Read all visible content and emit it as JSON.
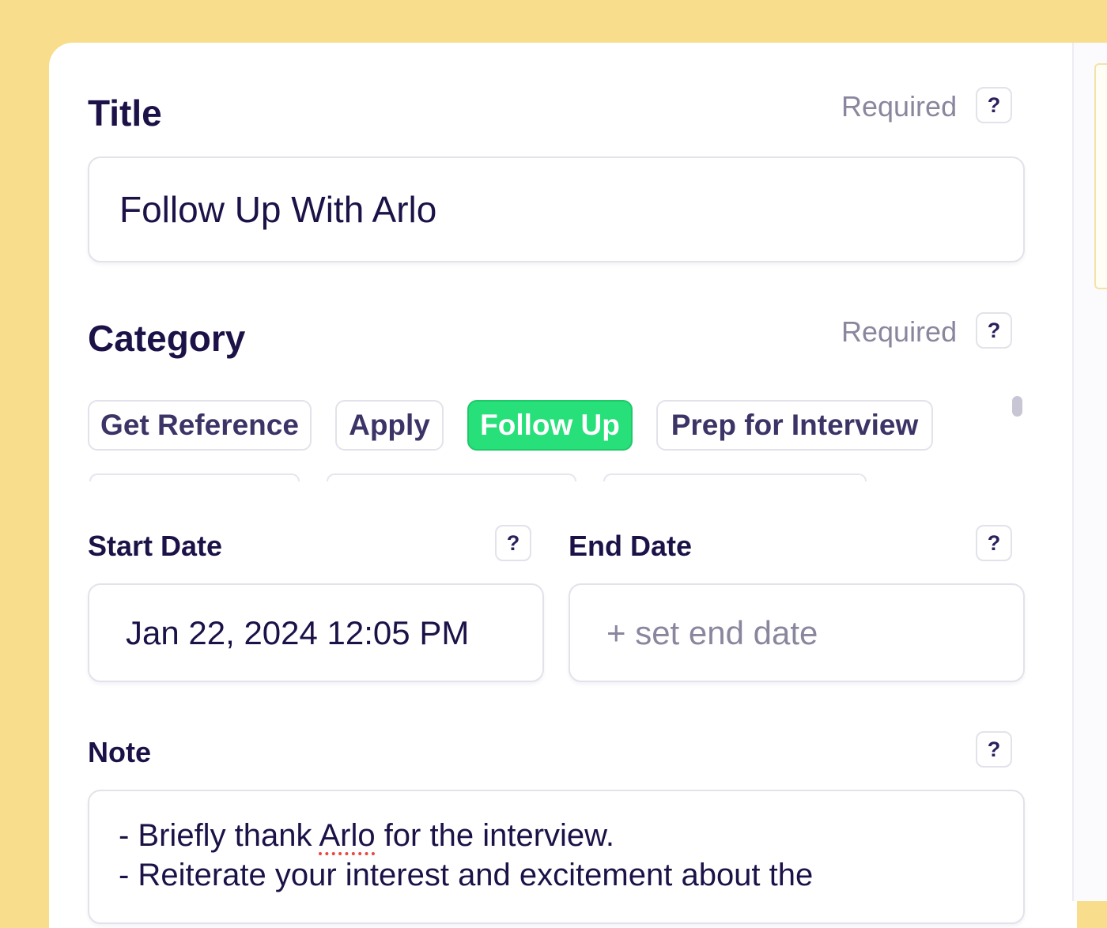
{
  "title_section": {
    "label": "Title",
    "required": "Required",
    "help": "?",
    "value": "Follow Up With Arlo"
  },
  "category_section": {
    "label": "Category",
    "required": "Required",
    "help": "?",
    "chips": [
      {
        "label": "Get Reference",
        "selected": false
      },
      {
        "label": "Apply",
        "selected": false
      },
      {
        "label": "Follow Up",
        "selected": true
      },
      {
        "label": "Prep for Interview",
        "selected": false
      }
    ]
  },
  "start_date": {
    "label": "Start Date",
    "help": "?",
    "value": "Jan 22, 2024 12:05 PM"
  },
  "end_date": {
    "label": "End Date",
    "help": "?",
    "placeholder": "+ set end date"
  },
  "note_section": {
    "label": "Note",
    "help": "?",
    "line1_before": "- Briefly thank ",
    "line1_flagged": "Arlo",
    "line1_after": " for the interview.",
    "line2": "- Reiterate your interest and excitement about the"
  },
  "colors": {
    "background": "#f7dd8c",
    "selected_chip": "#27e07a",
    "text": "#1c1248",
    "muted": "#8a869e"
  }
}
